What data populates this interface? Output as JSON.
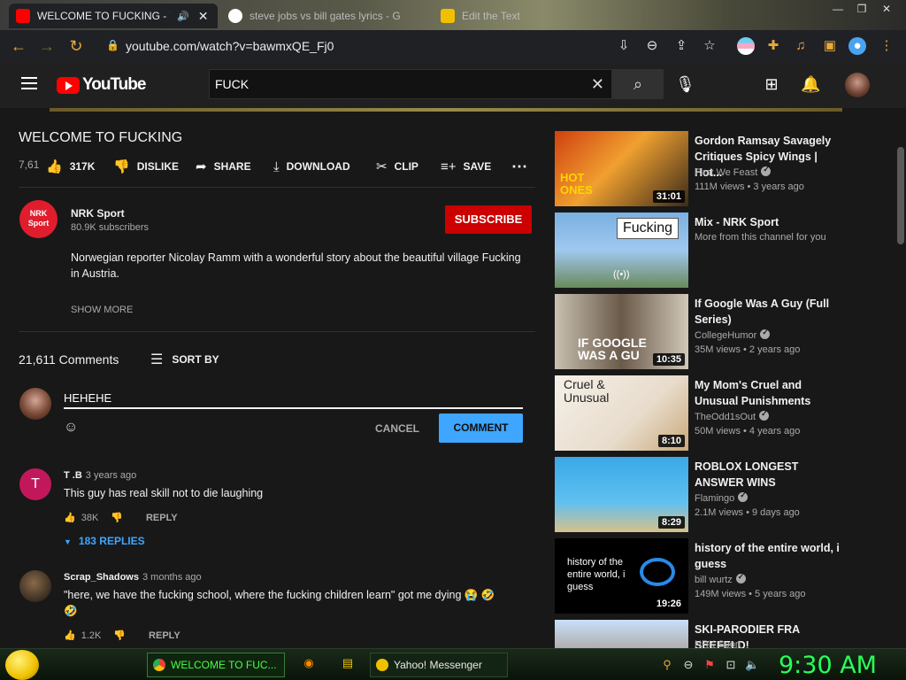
{
  "browser": {
    "tabs": [
      {
        "label": "WELCOME TO FUCKING - Yo",
        "active": true
      },
      {
        "label": "steve jobs vs bill gates lyrics - G",
        "active": false
      },
      {
        "label": "Edit the Text",
        "active": false
      }
    ],
    "url": "youtube.com/watch?v=bawmxQE_Fj0"
  },
  "header": {
    "logo": "YouTube",
    "search_query": "FUCK"
  },
  "video": {
    "title": "WELCOME TO FUCKING",
    "views_truncated": "7,61",
    "likes": "317K",
    "dislike_label": "DISLIKE",
    "share_label": "SHARE",
    "download_label": "DOWNLOAD",
    "clip_label": "CLIP",
    "save_label": "SAVE"
  },
  "channel": {
    "avatar_text": "NRK Sport",
    "name": "NRK Sport",
    "subscribers": "80.9K subscribers",
    "subscribe_label": "SUBSCRIBE"
  },
  "description": {
    "text": "Norwegian reporter Nicolay Ramm with a wonderful story about the beautiful village Fucking in Austria.",
    "show_more": "SHOW MORE"
  },
  "comments": {
    "count": "21,611 Comments",
    "sort_label": "SORT BY",
    "draft": "HEHEHE",
    "cancel_label": "CANCEL",
    "submit_label": "COMMENT",
    "items": [
      {
        "initial": "T",
        "author": "T .B",
        "time": "3 years ago",
        "text": "This guy has real skill not to die laughing",
        "likes": "38K",
        "reply_label": "REPLY",
        "replies": "183 REPLIES"
      },
      {
        "initial": "",
        "author": "Scrap_Shadows",
        "time": "3 months ago",
        "text": "\"here, we have the fucking school, where the fucking children learn\" got me dying 😭 🤣\n🤣",
        "likes": "1.2K",
        "reply_label": "REPLY"
      }
    ]
  },
  "recommendations": [
    {
      "title": "Gordon Ramsay Savagely Critiques Spicy Wings | Hot...",
      "channel": "First We Feast",
      "verified": true,
      "meta": "111M views • 3 years ago",
      "duration": "31:01",
      "thumb_text": "HOT ONES"
    },
    {
      "title": "Mix - NRK Sport",
      "channel": "More from this channel for you",
      "verified": false,
      "meta": "",
      "duration": "",
      "thumb_text": "Fucking"
    },
    {
      "title": "If Google Was A Guy (Full Series)",
      "channel": "CollegeHumor",
      "verified": true,
      "meta": "35M views • 2 years ago",
      "duration": "10:35",
      "thumb_text": "IF GOOGLE WAS A GU"
    },
    {
      "title": "My Mom's Cruel and Unusual Punishments",
      "channel": "TheOdd1sOut",
      "verified": true,
      "meta": "50M views • 4 years ago",
      "duration": "8:10",
      "thumb_text": "Cruel & Unusual"
    },
    {
      "title": "ROBLOX LONGEST ANSWER WINS",
      "channel": "Flamingo",
      "verified": true,
      "meta": "2.1M views • 9 days ago",
      "duration": "8:29",
      "thumb_text": ""
    },
    {
      "title": "history of the entire world, i guess",
      "channel": "bill wurtz",
      "verified": true,
      "meta": "149M views • 5 years ago",
      "duration": "19:26",
      "thumb_text": "history of the entire world, i guess"
    },
    {
      "title": "SKI-PARODIER FRA SEEFELD!",
      "channel": "NRK Sport",
      "verified": false,
      "meta": "",
      "duration": "",
      "thumb_text": ""
    }
  ],
  "taskbar": {
    "tasks": [
      {
        "label": "WELCOME TO FUC...",
        "active": true
      },
      {
        "label": "Yahoo! Messenger",
        "active": false
      }
    ],
    "clock": "9:30 AM"
  },
  "colors": {
    "accent_red": "#cc0000",
    "link_blue": "#3ea6ff",
    "clock_green": "#2aff5a",
    "chrome_icon_orange": "#e8aa3a"
  }
}
